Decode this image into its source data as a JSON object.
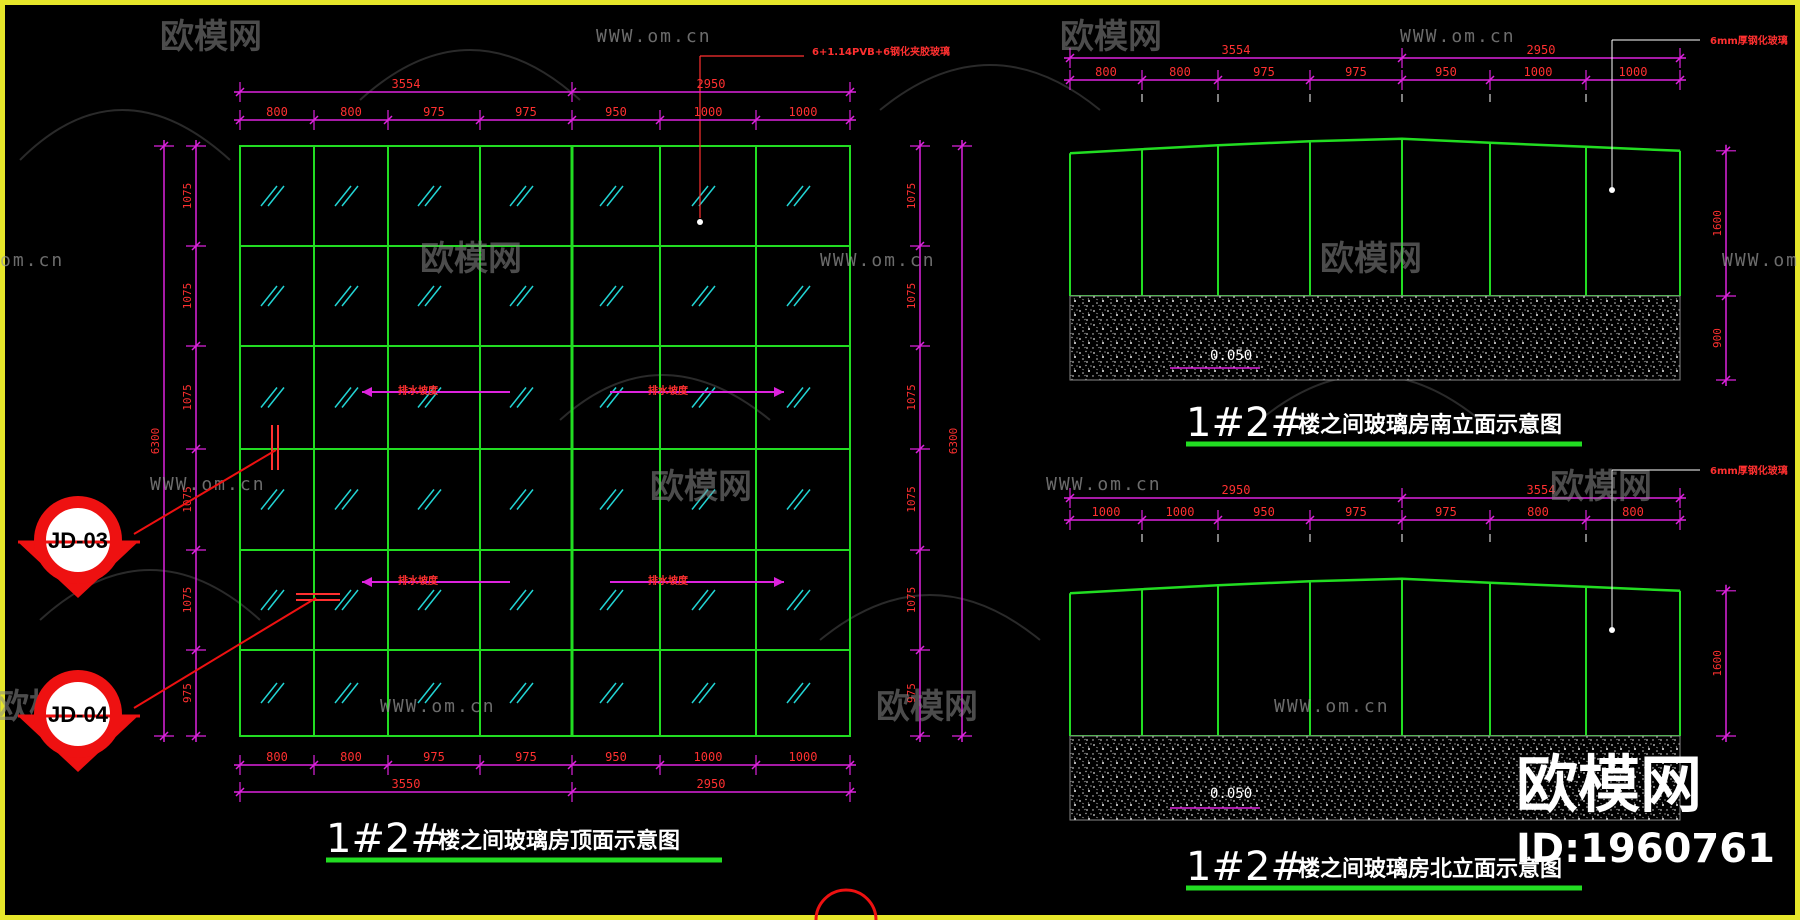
{
  "watermarks": {
    "brand": "欧模网",
    "url": "WWW.om.cn",
    "url_partial": "om.cn"
  },
  "notes": {
    "glass_spec": "6+1.14PVB+6钢化夹胶玻璃",
    "steel_right_1": "6mm厚钢化玻璃",
    "steel_right_2": "6mm厚钢化玻璃",
    "drain_label": "排水坡度"
  },
  "plan": {
    "title_num": "1#2#",
    "title_text": "楼之间玻璃房顶面示意图",
    "top_total": [
      "3554",
      "2950"
    ],
    "top_segments": [
      "800",
      "800",
      "975",
      "975",
      "950",
      "1000",
      "1000"
    ],
    "bottom_segments": [
      "800",
      "800",
      "975",
      "975",
      "950",
      "1000",
      "1000"
    ],
    "bottom_total": [
      "3550",
      "2950"
    ],
    "left_segments": [
      "1075",
      "1075",
      "1075",
      "1075",
      "1075",
      "975"
    ],
    "right_segments": [
      "1075",
      "1075",
      "1075",
      "1075",
      "1075",
      "975"
    ],
    "overall_height": "6300",
    "callouts": [
      "JD-03",
      "JD-04"
    ]
  },
  "south": {
    "title_num": "1#2#",
    "title_text": "楼之间玻璃房南立面示意图",
    "totals": [
      "3554",
      "2950"
    ],
    "segments": [
      "800",
      "800",
      "975",
      "975",
      "950",
      "1000",
      "1000"
    ],
    "heights": [
      "1600",
      "900"
    ],
    "level": "0.050"
  },
  "north": {
    "title_num": "1#2#",
    "title_text": "楼之间玻璃房北立面示意图",
    "totals": [
      "2950",
      "3554"
    ],
    "segments": [
      "1000",
      "1000",
      "950",
      "975",
      "975",
      "800",
      "800"
    ],
    "heights": [
      "1600"
    ],
    "level": "0.050"
  },
  "id_brand": {
    "brand": "欧模网",
    "id": "ID:1960761"
  },
  "colors": {
    "frame": "#e6e62a",
    "grid": "#22dd22",
    "dimension": "#dd22dd",
    "text_red": "#ff3030",
    "glass_hatch": "#22d4d4",
    "title_underline": "#22dd22"
  }
}
